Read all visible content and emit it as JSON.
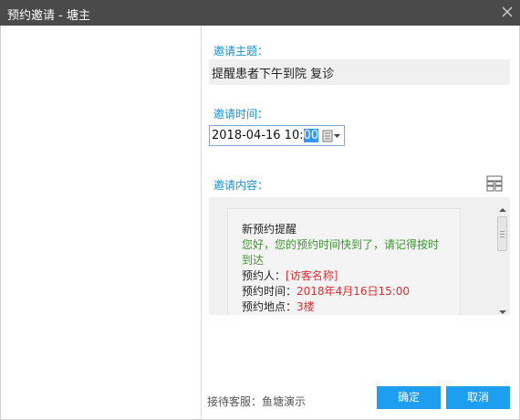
{
  "window": {
    "title": "预约邀请 - 塘主"
  },
  "form": {
    "topic_label": "邀请主题：",
    "topic_value": "提醒患者下午到院 复诊",
    "time_label": "邀请时间：",
    "time_value_prefix": "2018-04-16 10:",
    "time_value_selected": "00",
    "content_label": "邀请内容："
  },
  "message": {
    "title": "新预约提醒",
    "greeting": "您好，您的预约时间快到了，请记得按时到达",
    "booker_label": "预约人：",
    "booker_value": "[访客名称]",
    "time_label": "预约时间：",
    "time_value": "2018年4月16日15:00",
    "place_label": "预约地点：",
    "place_value": "3楼"
  },
  "footer": {
    "host": "接待客服：鱼塘演示",
    "confirm_label": "确定",
    "cancel_label": "取消"
  },
  "colors": {
    "accent": "#1e9ef0",
    "label": "#1a8fd6",
    "greeting": "#3a9a2a",
    "highlight": "#e03030"
  },
  "icons": [
    "close-icon",
    "calendar-icon",
    "chevron-down-icon",
    "layout-icon",
    "scroll-up-icon",
    "scroll-down-icon"
  ]
}
